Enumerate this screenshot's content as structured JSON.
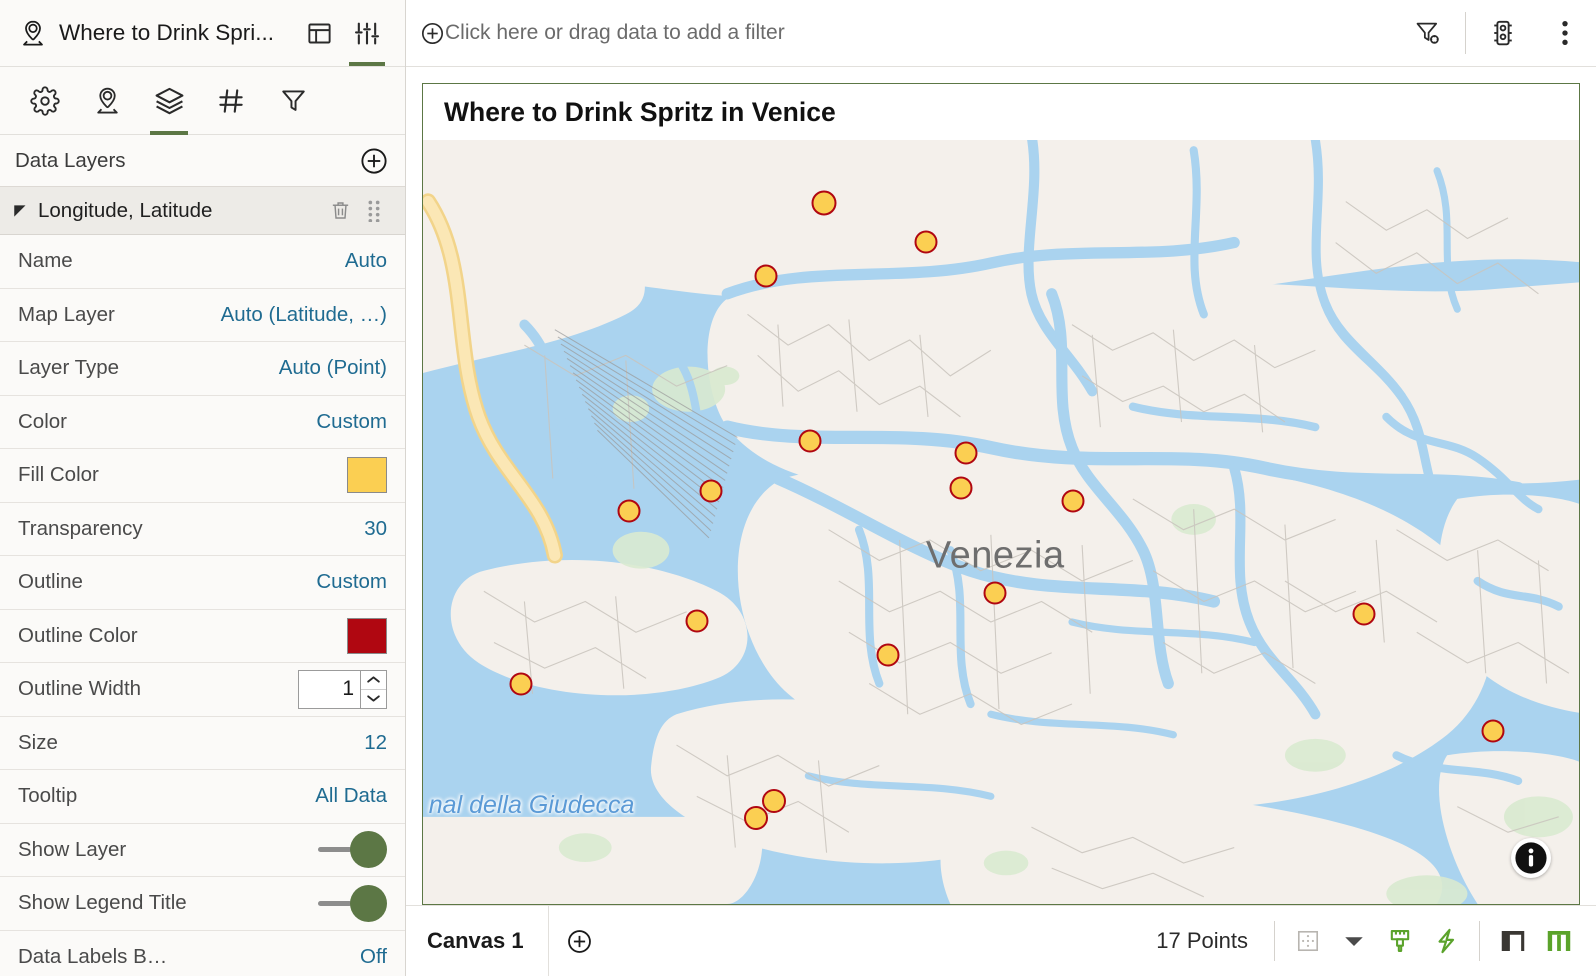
{
  "sidebar": {
    "title": "Where to Drink Spri...",
    "title_icon": "map-pin-person-icon",
    "titlebar_buttons": [
      {
        "name": "panel-layout-button",
        "icon": "panel-layout-icon",
        "active": false
      },
      {
        "name": "properties-button",
        "icon": "sliders-icon",
        "active": true
      }
    ],
    "icon_tabs": [
      {
        "name": "tab-settings",
        "icon": "gear-icon",
        "active": false
      },
      {
        "name": "tab-map",
        "icon": "map-pin-person-icon",
        "active": false
      },
      {
        "name": "tab-layers",
        "icon": "layers-icon",
        "active": true
      },
      {
        "name": "tab-numbers",
        "icon": "hash-icon",
        "active": false
      },
      {
        "name": "tab-filters",
        "icon": "funnel-icon",
        "active": false
      }
    ],
    "section_header": {
      "label": "Data Layers",
      "add_icon": "plus-circle-icon"
    },
    "layer": {
      "name": "Longitude, Latitude",
      "caret_icon": "collapse-triangle-icon",
      "delete_icon": "trash-icon",
      "drag_icon": "drag-handle-icon"
    },
    "properties": [
      {
        "label": "Name",
        "value": "Auto",
        "type": "link"
      },
      {
        "label": "Map Layer",
        "value": "Auto (Latitude, …)",
        "type": "link"
      },
      {
        "label": "Layer Type",
        "value": "Auto (Point)",
        "type": "link"
      },
      {
        "label": "Color",
        "value": "Custom",
        "type": "link"
      },
      {
        "label": "Fill Color",
        "value": "#FBCF52",
        "type": "swatch"
      },
      {
        "label": "Transparency",
        "value": "30",
        "type": "link"
      },
      {
        "label": "Outline",
        "value": "Custom",
        "type": "link"
      },
      {
        "label": "Outline Color",
        "value": "#B00711",
        "type": "swatch"
      },
      {
        "label": "Outline Width",
        "value": "1",
        "type": "number"
      },
      {
        "label": "Size",
        "value": "12",
        "type": "link"
      },
      {
        "label": "Tooltip",
        "value": "All Data",
        "type": "link"
      },
      {
        "label": "Show Layer",
        "value": "On",
        "type": "toggle"
      },
      {
        "label": "Show Legend Title",
        "value": "On",
        "type": "toggle"
      },
      {
        "label": "Data Labels B…",
        "value": "Off",
        "type": "link"
      }
    ]
  },
  "filterbar": {
    "hint": "Click here or drag data to add a filter",
    "add_icon": "plus-circle-icon",
    "buttons": [
      {
        "name": "filter-settings-button",
        "icon": "funnel-gear-icon"
      },
      {
        "name": "data-actions-button",
        "icon": "traffic-light-icon"
      },
      {
        "name": "more-options-button",
        "icon": "kebab-menu-icon"
      }
    ]
  },
  "map": {
    "title": "Where to Drink Spritz in Venice",
    "city_label": "Venezia",
    "water_label": "nal della Giudecca",
    "info_icon": "info-icon",
    "point_fill": "#FBCF52",
    "point_outline": "#B00711",
    "points": [
      {
        "x": 34.7,
        "y": 8.2
      },
      {
        "x": 43.5,
        "y": 13.4
      },
      {
        "x": 29.7,
        "y": 17.8
      },
      {
        "x": 33.5,
        "y": 39.4
      },
      {
        "x": 47.0,
        "y": 41.0
      },
      {
        "x": 24.9,
        "y": 46.0
      },
      {
        "x": 46.5,
        "y": 45.5
      },
      {
        "x": 17.8,
        "y": 48.5
      },
      {
        "x": 56.2,
        "y": 47.3
      },
      {
        "x": 49.5,
        "y": 59.3
      },
      {
        "x": 81.4,
        "y": 62.1
      },
      {
        "x": 23.7,
        "y": 63.0
      },
      {
        "x": 40.2,
        "y": 67.4
      },
      {
        "x": 8.5,
        "y": 71.2
      },
      {
        "x": 92.6,
        "y": 77.3
      },
      {
        "x": 30.4,
        "y": 86.5
      },
      {
        "x": 28.8,
        "y": 88.8
      }
    ]
  },
  "statusbar": {
    "canvas_tab": "Canvas 1",
    "add_canvas_icon": "plus-circle-icon",
    "point_count": "17 Points",
    "buttons": [
      {
        "name": "snap-grid-button",
        "icon": "grid-snap-icon"
      },
      {
        "name": "snap-dropdown-button",
        "icon": "chevron-down-icon"
      },
      {
        "name": "style-brush-button",
        "icon": "paintbrush-icon"
      },
      {
        "name": "quick-actions-button",
        "icon": "lightning-icon"
      },
      {
        "name": "left-panel-toggle",
        "icon": "panel-left-icon"
      },
      {
        "name": "right-panel-toggle",
        "icon": "panel-right-icon"
      }
    ]
  },
  "colors": {
    "accent_green": "#5C7745",
    "link_blue": "#1F6B91",
    "water": "#AAD3EF",
    "land": "#F4F0EB"
  }
}
